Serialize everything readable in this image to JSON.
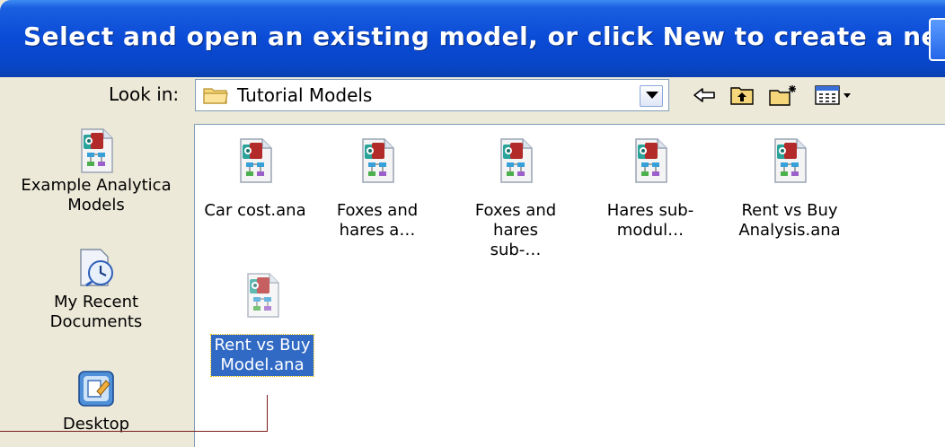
{
  "dialog": {
    "title": "Select and open an existing model, or click New to create a new model"
  },
  "lookin": {
    "label": "Look in:",
    "value": "Tutorial Models"
  },
  "toolbar": {
    "icons": [
      "back-arrow-icon",
      "up-folder-icon",
      "new-folder-icon",
      "views-menu-icon"
    ]
  },
  "places": [
    {
      "label": "Example Analytica Models",
      "icon": "analytica-model-icon"
    },
    {
      "label": "My Recent Documents",
      "icon": "recent-documents-icon"
    },
    {
      "label": "Desktop",
      "icon": "desktop-icon"
    }
  ],
  "files": [
    {
      "name": "Car cost.ana",
      "selected": false
    },
    {
      "name": "Foxes and hares a…",
      "selected": false
    },
    {
      "name": "Foxes and hares sub-…",
      "selected": false
    },
    {
      "name": "Hares sub-modul…",
      "selected": false
    },
    {
      "name": "Rent vs Buy Analysis.ana",
      "selected": false
    },
    {
      "name": "Rent vs Buy Model.ana",
      "selected": true
    }
  ],
  "colors": {
    "title_bar": "#0a4bd6",
    "selection": "#316ac5",
    "dialog_bg": "#ece9d8",
    "callout_line": "#7a1d1d"
  }
}
